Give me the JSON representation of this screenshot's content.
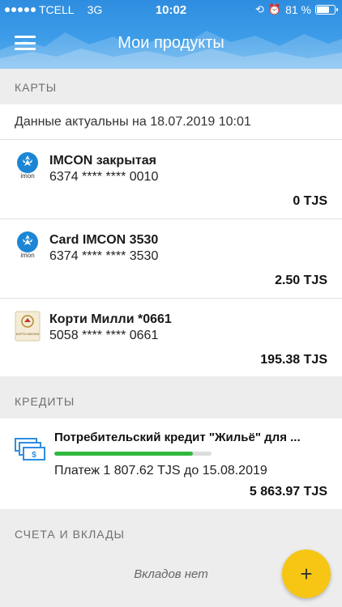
{
  "status_bar": {
    "carrier": "TCELL",
    "network": "3G",
    "time": "10:02",
    "battery": "81 %",
    "battery_level": 0.81
  },
  "header": {
    "title": "Мои продукты",
    "menu_icon": "hamburger-icon"
  },
  "colors": {
    "header": "#3d9ce8",
    "fab": "#f7c615",
    "progress": "#2fb83f",
    "section_bg": "#ededed"
  },
  "sections": {
    "cards": {
      "title": "КАРТЫ",
      "actual": "Данные актуальны на 18.07.2019 10:01",
      "items": [
        {
          "name": "IMCON закрытая",
          "number": "6374 **** **** 0010",
          "amount": "0 TJS",
          "logo": "imon-logo-icon",
          "logo_text": "imon"
        },
        {
          "name": "Card IMCON 3530",
          "number": "6374 **** **** 3530",
          "amount": "2.50 TJS",
          "logo": "imon-logo-icon",
          "logo_text": "imon"
        },
        {
          "name": "Корти Милли *0661",
          "number": "5058 **** **** 0661",
          "amount": "195.38 TJS",
          "logo": "korti-milli-logo-icon",
          "logo_text": "КОРТИ МИЛЛИ"
        }
      ]
    },
    "credits": {
      "title": "КРЕДИТЫ",
      "item": {
        "name": "Потребительский кредит \"Жильё\" для ...",
        "payment": "Платеж 1 807.62 TJS до 15.08.2019",
        "amount": "5 863.97 TJS",
        "progress": 0.88,
        "icon": "money-stack-icon"
      }
    },
    "accounts": {
      "title": "СЧЕТА И ВКЛАДЫ",
      "empty": "Вкладов нет"
    }
  },
  "fab": {
    "label": "+",
    "icon": "plus-icon"
  }
}
